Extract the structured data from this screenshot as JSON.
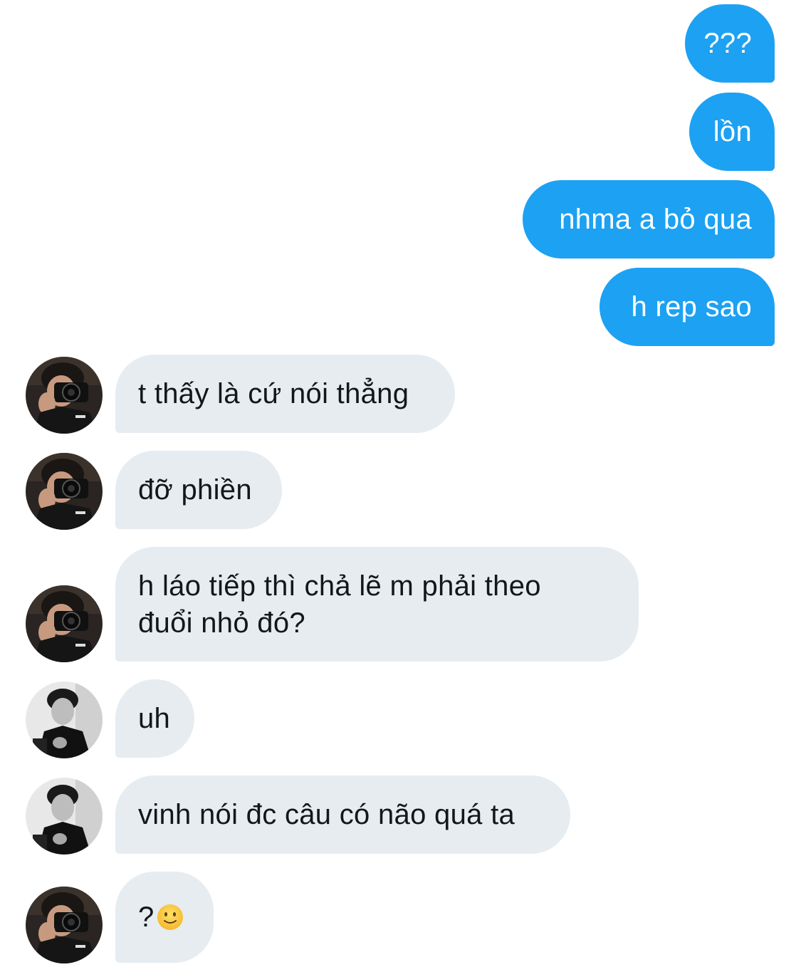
{
  "conversation": {
    "sent": [
      {
        "text": "???"
      },
      {
        "text": "lồn"
      },
      {
        "text": "nhma a bỏ qua"
      },
      {
        "text": "h rep sao"
      }
    ],
    "received": [
      {
        "text": "t thấy là cứ nói thẳng",
        "avatar": "camera-person-avatar"
      },
      {
        "text": "đỡ phiền",
        "avatar": "camera-person-avatar"
      },
      {
        "line1": "h láo tiếp thì chả lẽ m phải theo",
        "line2": "đuổi nhỏ đó?",
        "avatar": "camera-person-avatar"
      },
      {
        "text": "uh",
        "avatar": "bw-portrait-avatar"
      },
      {
        "text": "vinh nói đc câu có não quá ta",
        "avatar": "bw-portrait-avatar"
      },
      {
        "text": "?",
        "emoji": "slightly-smiling-face",
        "avatar": "camera-person-avatar"
      }
    ]
  },
  "colors": {
    "sent_bubble": "#1da1f2",
    "received_bubble": "#e6ecf0",
    "sent_text": "#ffffff",
    "received_text": "#14171a"
  }
}
